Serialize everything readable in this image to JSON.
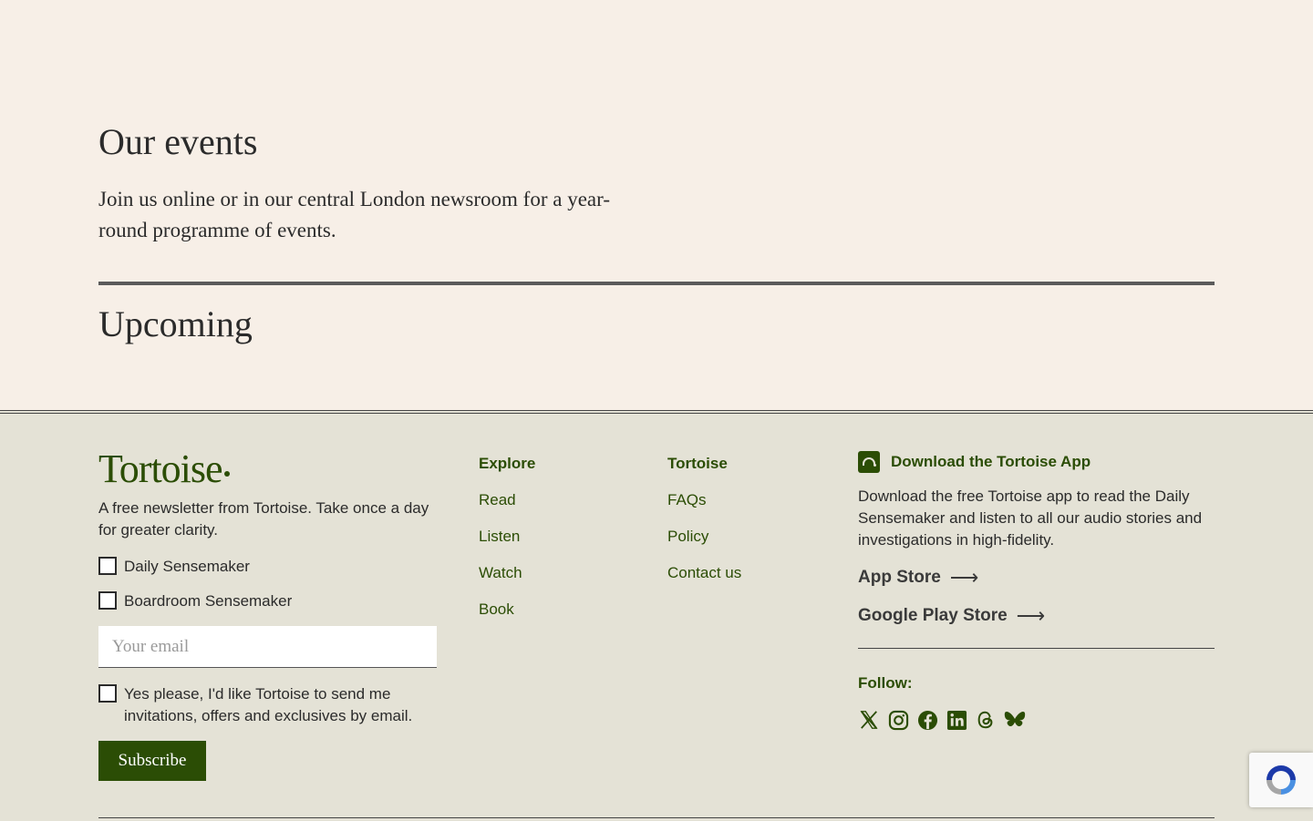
{
  "events": {
    "title": "Our events",
    "description": "Join us online or in our central London newsroom for a year-round programme of events.",
    "upcoming_heading": "Upcoming"
  },
  "footer": {
    "logo": "Tortoise",
    "newsletter_text": "A free newsletter from Tortoise. Take once a day for greater clarity.",
    "newsletters": [
      "Daily Sensemaker",
      "Boardroom Sensemaker"
    ],
    "email_placeholder": "Your email",
    "consent_text": "Yes please, I'd like Tortoise to send me invitations, offers and exclusives by email.",
    "subscribe_label": "Subscribe",
    "explore": {
      "heading": "Explore",
      "links": [
        "Read",
        "Listen",
        "Watch",
        "Book"
      ]
    },
    "tortoise": {
      "heading": "Tortoise",
      "links": [
        "FAQs",
        "Policy",
        "Contact us"
      ]
    },
    "app": {
      "heading": "Download the Tortoise App",
      "description": "Download the free Tortoise app to read the Daily Sensemaker and listen to all our audio stories and investigations in high-fidelity.",
      "app_store": "App Store",
      "play_store": "Google Play Store",
      "arrow": "⟶"
    },
    "follow_label": "Follow:",
    "socials": [
      "x-icon",
      "instagram-icon",
      "facebook-icon",
      "linkedin-icon",
      "threads-icon",
      "bluesky-icon"
    ]
  },
  "colors": {
    "brand_green": "#2b4d05",
    "page_bg": "#f7efe7",
    "footer_bg": "#e4e2d6"
  }
}
